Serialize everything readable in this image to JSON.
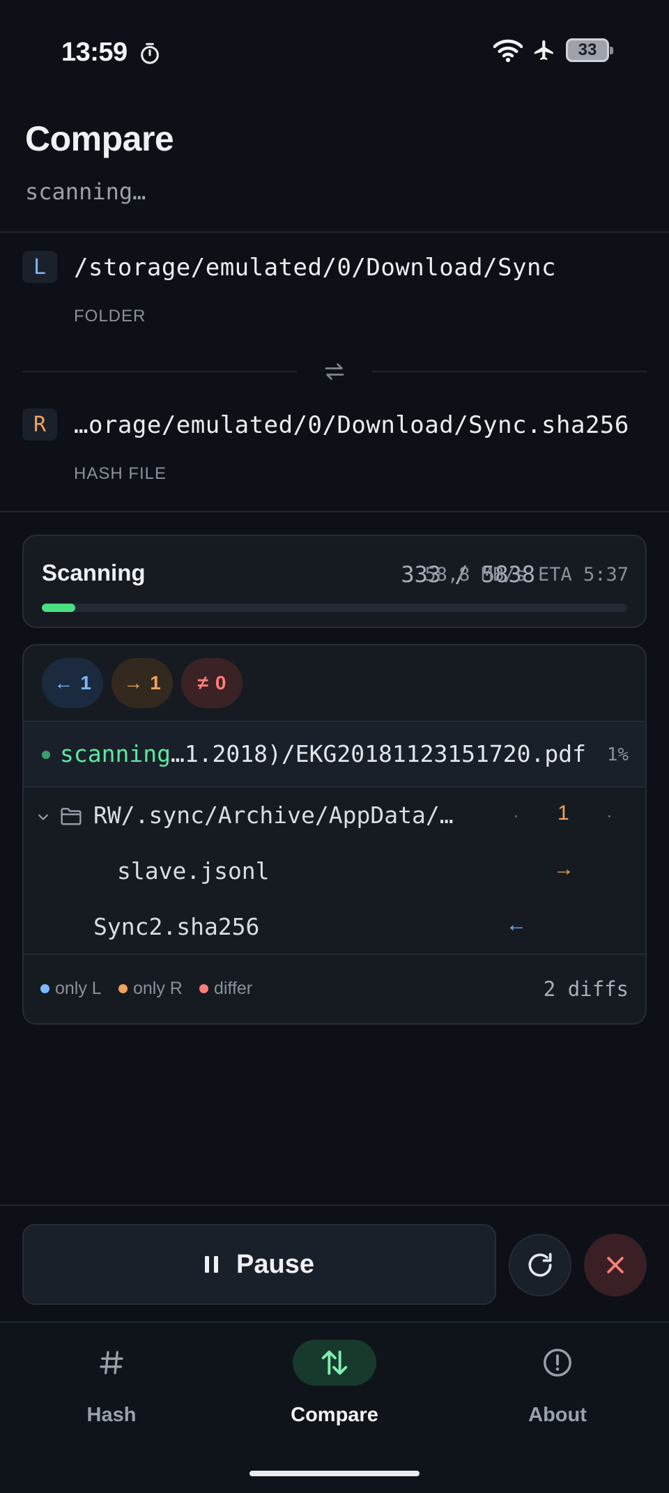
{
  "status_bar": {
    "time": "13:59",
    "battery": "33"
  },
  "header": {
    "title": "Compare",
    "subtitle": "scanning…"
  },
  "left": {
    "badge": "L",
    "path": "/storage/emulated/0/Download/Sync",
    "kind": "FOLDER"
  },
  "right": {
    "badge": "R",
    "path": "…orage/emulated/0/Download/Sync.sha256",
    "kind": "HASH FILE"
  },
  "progress": {
    "label": "Scanning",
    "count": "333 / 5838",
    "rate": "58,8 MB/s ETA 5:37",
    "fraction": 0.057
  },
  "chips": {
    "left_glyph": "←",
    "left_count": "1",
    "right_glyph": "→",
    "right_count": "1",
    "diff_glyph": "≠",
    "diff_count": "0"
  },
  "scan": {
    "prefix": "scanning",
    "file": "…1.2018)/EKG20181123151720.pdf",
    "pct": "1%"
  },
  "tree": {
    "folder": {
      "name": "RW/.sync/Archive/AppData/…",
      "col_l": "·",
      "col_r": "1",
      "col_d": "·"
    },
    "child": {
      "name": "slave.jsonl",
      "arrow": "→"
    },
    "file": {
      "name": "Sync2.sha256",
      "arrow": "←"
    }
  },
  "legend": {
    "only_l": "only L",
    "only_r": "only R",
    "differ": "differ",
    "total": "2 diffs"
  },
  "actions": {
    "pause_label": "Pause"
  },
  "nav": {
    "hash_label": "Hash",
    "compare_label": "Compare",
    "about_label": "About",
    "active": "Compare"
  },
  "colors": {
    "only_l": "#7cb7ff",
    "only_r": "#f0a35a",
    "differ": "#ff7e79",
    "accent": "#4ade80"
  }
}
